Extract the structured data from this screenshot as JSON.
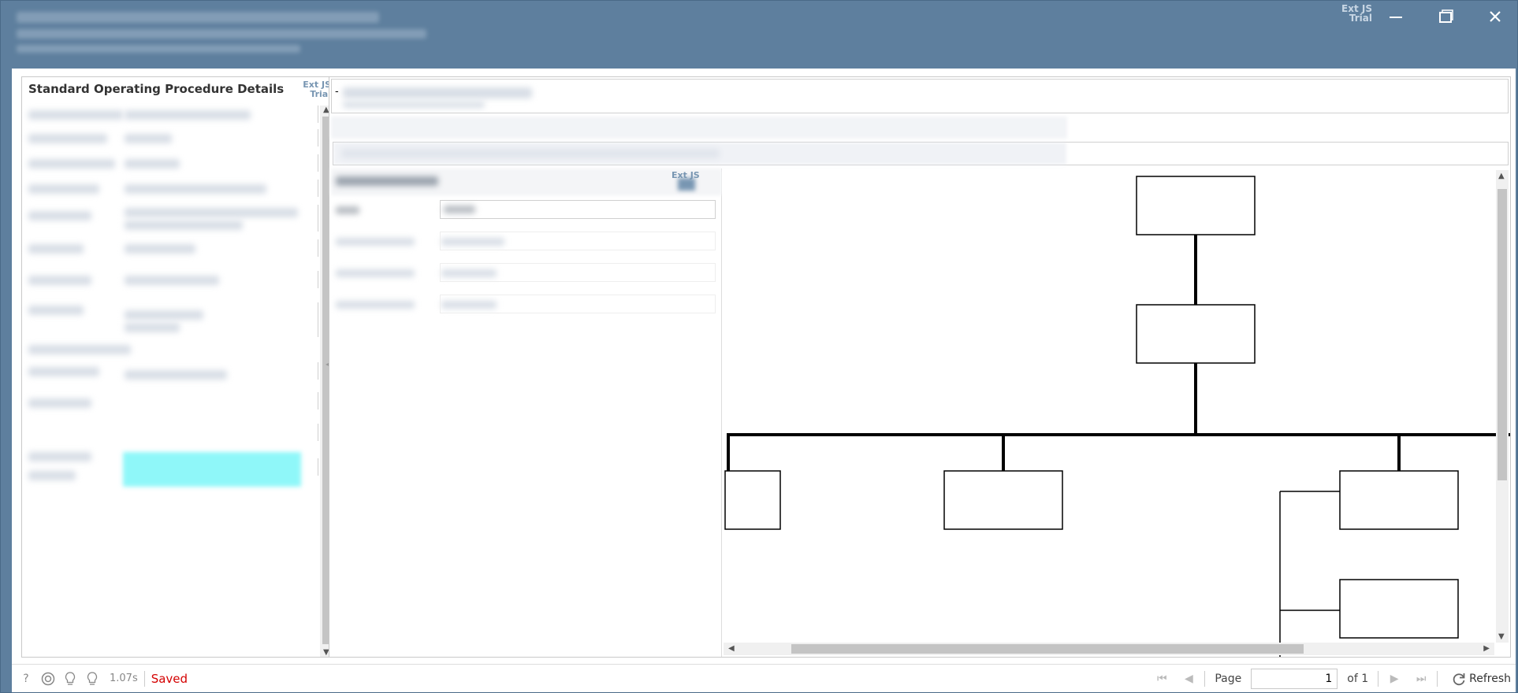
{
  "window": {
    "trial_line1": "Ext JS",
    "trial_line2": "Trial"
  },
  "left_panel": {
    "title": "Standard Operating Procedure Details",
    "trial_line1": "Ext JS",
    "trial_line2": "Trial"
  },
  "mid_panel": {
    "trial_line1": "Ext JS"
  },
  "header_dash": "-",
  "statusbar": {
    "help": "?",
    "timing": "1.07s",
    "saved": "Saved",
    "page_label": "Page",
    "page_value": "1",
    "of_label": "of 1",
    "refresh": "Refresh"
  },
  "icons": {
    "minimize": "minimize-icon",
    "maximize": "maximize-icon",
    "close": "close-icon",
    "support": "lifebuoy-icon",
    "bulb": "lightbulb-icon",
    "refresh": "refresh-icon"
  }
}
